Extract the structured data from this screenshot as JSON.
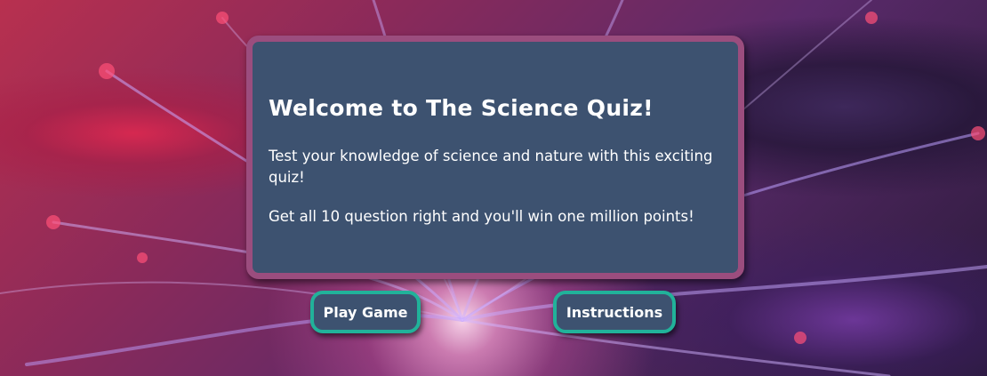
{
  "welcome": {
    "heading": "Welcome to The Science Quiz!",
    "intro": "Test your knowledge of science and nature with this exciting quiz!",
    "goal": "Get all 10 question right and you'll win one million points!"
  },
  "buttons": {
    "play_label": "Play Game",
    "instructions_label": "Instructions"
  },
  "colors": {
    "card_background": "#3d5270",
    "card_border": "#9b4d7e",
    "button_border": "#21b29a",
    "text": "#ffffff"
  }
}
